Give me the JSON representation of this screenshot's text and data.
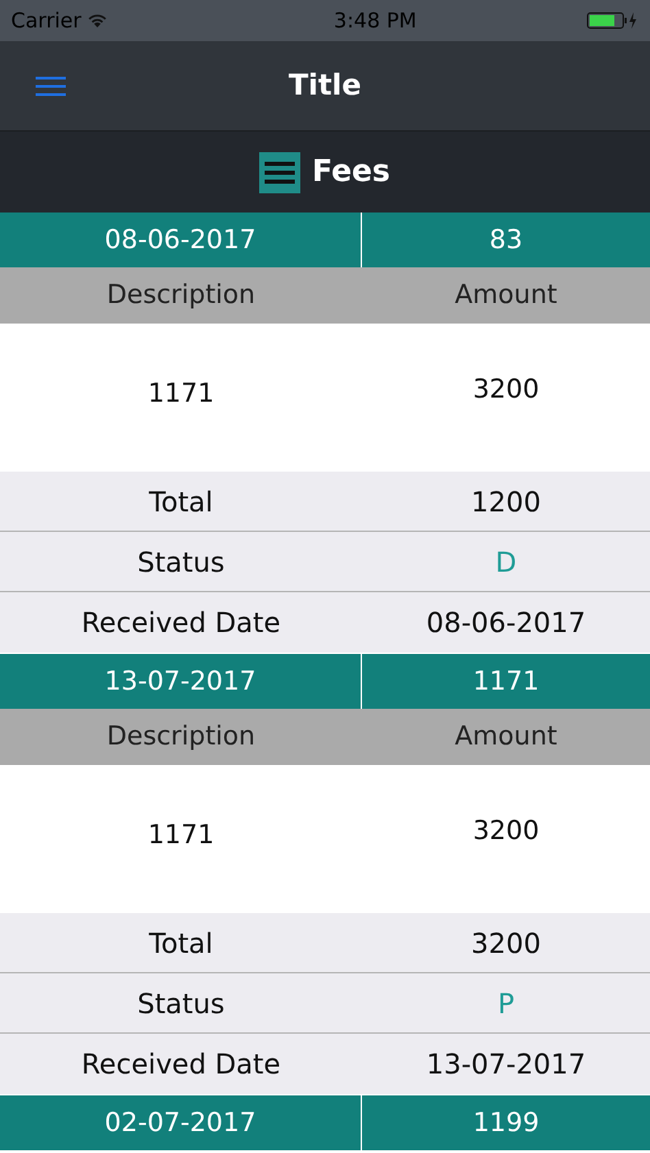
{
  "status_bar": {
    "carrier": "Carrier",
    "time": "3:48 PM"
  },
  "nav": {
    "title": "Title"
  },
  "section": {
    "title": "Fees"
  },
  "fees": [
    {
      "date": "08-06-2017",
      "number": "83",
      "columns": [
        "Description",
        "Amount"
      ],
      "items": [
        {
          "description": "1171",
          "amount": "3200"
        }
      ],
      "summary": [
        {
          "label": "Total",
          "value": "1200",
          "kind": "plain"
        },
        {
          "label": "Status",
          "value": "D",
          "kind": "status"
        },
        {
          "label": "Received Date",
          "value": "08-06-2017",
          "kind": "plain"
        }
      ]
    },
    {
      "date": "13-07-2017",
      "number": "1171",
      "columns": [
        "Description",
        "Amount"
      ],
      "items": [
        {
          "description": "1171",
          "amount": "3200"
        }
      ],
      "summary": [
        {
          "label": "Total",
          "value": "3200",
          "kind": "plain"
        },
        {
          "label": "Status",
          "value": "P",
          "kind": "status"
        },
        {
          "label": "Received Date",
          "value": "13-07-2017",
          "kind": "plain"
        }
      ]
    },
    {
      "date": "02-07-2017",
      "number": "1199"
    }
  ]
}
